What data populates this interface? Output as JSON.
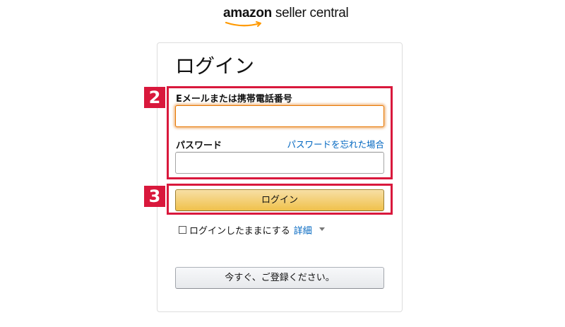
{
  "header": {
    "brand": "amazon",
    "product": " seller central"
  },
  "login": {
    "title": "ログイン",
    "email_label": "Eメールまたは携帯電話番号",
    "email_value": "",
    "password_label": "パスワード",
    "password_value": "",
    "forgot_password_link": "パスワードを忘れた場合",
    "submit_label": "ログイン",
    "remember_me_label": "ログインしたままにする",
    "details_link": "詳細",
    "register_label": "今すぐ、ご登録ください。"
  },
  "annotations": {
    "step_2": "2",
    "step_3": "3"
  },
  "colors": {
    "annotation_red": "#d9183c",
    "link_blue": "#0066c0",
    "button_gold": "#f0c14b",
    "focus_orange": "#e77600",
    "logo_smile": "#ff9900"
  },
  "icons": {
    "logo_smile": "amazon-smile-icon",
    "details_caret": "caret-down-icon",
    "remember_checkbox": "checkbox-icon"
  }
}
